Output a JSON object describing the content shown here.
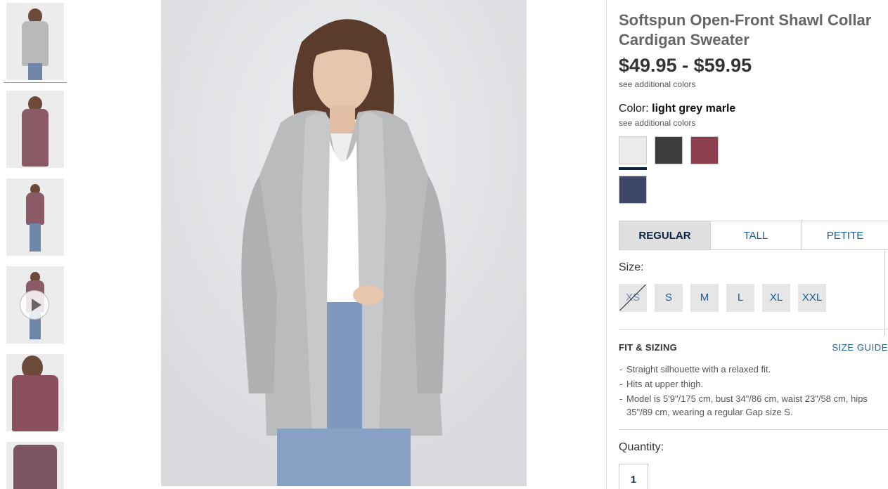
{
  "product": {
    "title": "Softspun Open-Front Shawl Collar Cardigan Sweater",
    "price": "$49.95 - $59.95",
    "see_additional_colors_top": "see additional colors",
    "color_label": "Color:",
    "color_value": "light grey marle",
    "see_additional_colors_color": "see additional colors",
    "swatches": [
      {
        "name": "light grey marle",
        "color": "#e8e8e8",
        "selected": true
      },
      {
        "name": "charcoal",
        "color": "#3a3a3a"
      },
      {
        "name": "burgundy",
        "color": "#8a3a4a"
      },
      {
        "name": "navy",
        "color": "#3b4466"
      }
    ]
  },
  "fit_tabs": [
    {
      "label": "REGULAR",
      "active": true
    },
    {
      "label": "TALL"
    },
    {
      "label": "PETITE"
    }
  ],
  "size": {
    "label": "Size:",
    "options": [
      {
        "label": "XS",
        "available": false
      },
      {
        "label": "S",
        "available": true
      },
      {
        "label": "M",
        "available": true
      },
      {
        "label": "L",
        "available": true
      },
      {
        "label": "XL",
        "available": true
      },
      {
        "label": "XXL",
        "available": true
      }
    ]
  },
  "fit_sizing": {
    "heading": "FIT & SIZING",
    "size_guide": "SIZE GUIDE",
    "bullets": [
      "Straight silhouette with a relaxed fit.",
      "Hits at upper thigh.",
      "Model is 5'9\"/175 cm, bust 34\"/86 cm, waist 23\"/58 cm, hips 35\"/89 cm, wearing a regular Gap size S."
    ]
  },
  "quantity": {
    "label": "Quantity:",
    "value": "1"
  },
  "colors": {
    "accent_link": "#1d5c94",
    "selected_navy": "#0b2240"
  }
}
